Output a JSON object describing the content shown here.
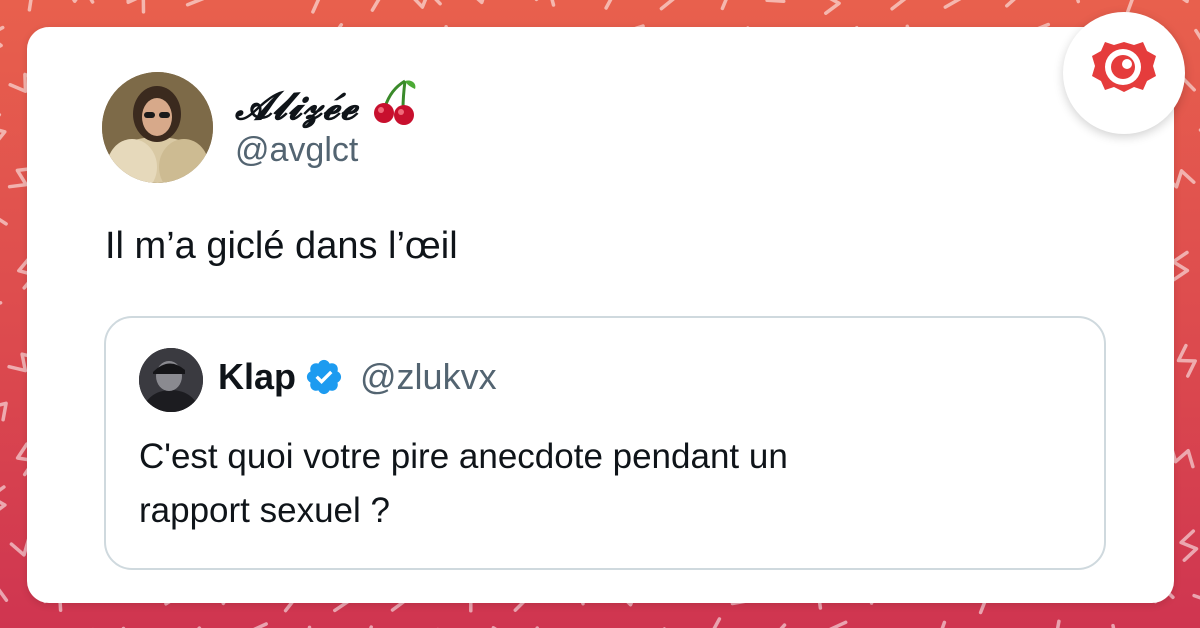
{
  "tweet": {
    "author_name": "𝓐𝓵𝓲𝔃𝓮́𝓮",
    "author_emoji": "cherries-icon",
    "author_handle": "@avglct",
    "text": "Il m’a giclé dans l’œil"
  },
  "quoted_tweet": {
    "author_name": "Klap",
    "verified_icon": "verified-badge-icon",
    "author_handle": "@zlukvx",
    "text_line1": "C'est quoi votre pire anecdote pendant un",
    "text_line2": "rapport sexuel ?"
  },
  "brand": {
    "logo": "brand-logo-icon"
  },
  "colors": {
    "background_top": "#e8604d",
    "background_bottom": "#cf3550",
    "card": "#ffffff",
    "handle_gray": "#536471",
    "verified_blue": "#1d9bf0",
    "quote_border": "#cfd9de",
    "brand_red": "#e53c3c"
  }
}
